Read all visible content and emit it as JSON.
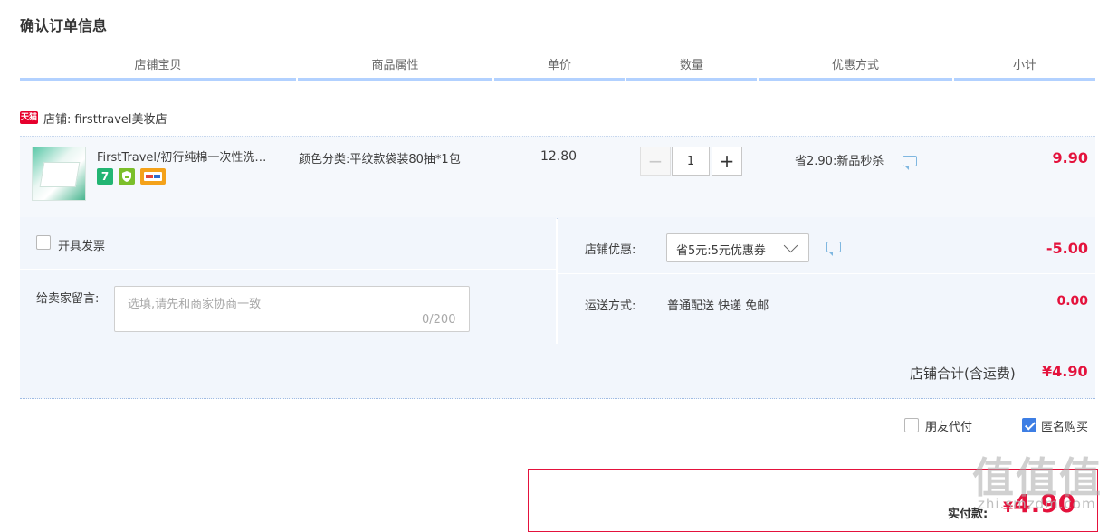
{
  "page": {
    "title": "确认订单信息"
  },
  "columns": [
    "店铺宝贝",
    "商品属性",
    "单价",
    "数量",
    "优惠方式",
    "小计"
  ],
  "shop": {
    "badge": "天猫",
    "label": "店铺:",
    "name": "firsttravel美妆店"
  },
  "item": {
    "title": "FirstTravel/初行纯棉一次性洗…",
    "badges": [
      "7",
      "",
      ""
    ],
    "sku": "颜色分类:平纹款袋装80抽*1包",
    "price": "12.80",
    "quantity": "1",
    "minus": "−",
    "plus": "+",
    "promo": "省2.90:新品秒杀",
    "subtotal": "9.90"
  },
  "invoice": {
    "label": "开具发票",
    "checked": false
  },
  "message": {
    "label": "给卖家留言:",
    "placeholder": "选填,请先和商家协商一致",
    "count": "0/200"
  },
  "shop_discount": {
    "label": "店铺优惠:",
    "selected": "省5元:5元优惠券",
    "amount": "-5.00"
  },
  "shipping": {
    "label": "运送方式:",
    "value": "普通配送 快递 免邮",
    "amount": "0.00"
  },
  "shop_total": {
    "label": "店铺合计(含运费)",
    "value": "¥4.90"
  },
  "options": {
    "friend_pay": {
      "label": "朋友代付",
      "checked": false
    },
    "anonymous": {
      "label": "匿名购买",
      "checked": true
    }
  },
  "payment": {
    "label": "实付款:",
    "symbol": "¥",
    "amount": "4.90"
  },
  "watermark": {
    "text": "值值值",
    "sub": "zhi.smzdm.com"
  },
  "colors": {
    "accent_red": "#e4123c",
    "header_line": "#b2d1ff",
    "panel_bg": "#f2f6fc",
    "check_blue": "#3d7ee4"
  }
}
